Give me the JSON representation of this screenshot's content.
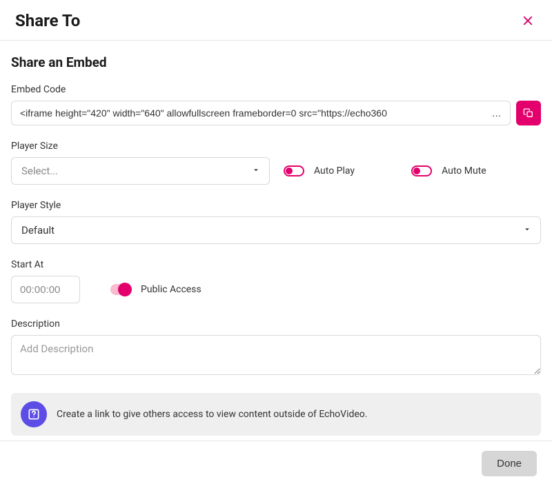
{
  "header": {
    "title": "Share To"
  },
  "body": {
    "section_title": "Share an Embed",
    "embed_code": {
      "label": "Embed Code",
      "value": "<iframe height=\"420\" width=\"640\" allowfullscreen frameborder=0 src=\"https://echo360                                              ..."
    },
    "player_size": {
      "label": "Player Size",
      "placeholder": "Select..."
    },
    "auto_play": {
      "label": "Auto Play",
      "value": false
    },
    "auto_mute": {
      "label": "Auto Mute",
      "value": false
    },
    "player_style": {
      "label": "Player Style",
      "value": "Default"
    },
    "start_at": {
      "label": "Start At",
      "placeholder": "00:00:00"
    },
    "public_access": {
      "label": "Public Access",
      "value": true
    },
    "description": {
      "label": "Description",
      "placeholder": "Add Description"
    },
    "info_text": "Create a link to give others access to view content outside of EchoVideo."
  },
  "footer": {
    "done_label": "Done"
  }
}
